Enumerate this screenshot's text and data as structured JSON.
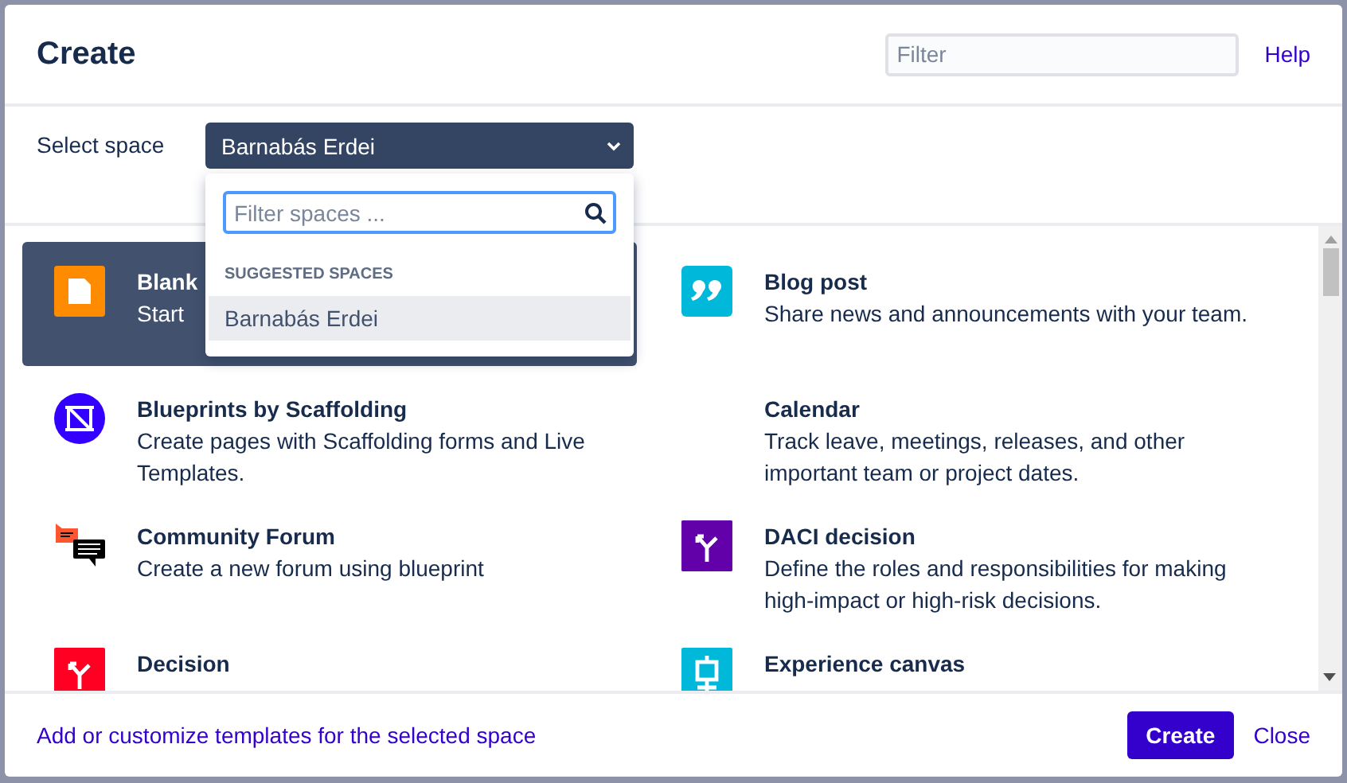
{
  "dialog": {
    "title": "Create",
    "filter": {
      "placeholder": "Filter"
    },
    "help": "Help"
  },
  "space": {
    "label": "Select space",
    "value": "Barnabás Erdei",
    "expanded": true,
    "dropdown": {
      "filter": {
        "placeholder": "Filter spaces ..."
      },
      "section": "SUGGESTED SPACES",
      "options": [
        {
          "label": "Barnabás Erdei",
          "selected": true
        }
      ]
    }
  },
  "templates": [
    {
      "kind": "page",
      "title": "Blank",
      "description": "Start",
      "selected": true
    },
    {
      "kind": "quote",
      "title": "Blog post",
      "description": "Share news and announcements with your team.",
      "selected": false
    },
    {
      "kind": "scaffold",
      "title": "Blueprints by Scaffolding",
      "description": "Create pages with Scaffolding forms and Live Templates.",
      "selected": false
    },
    {
      "kind": "none",
      "title": "Calendar",
      "description": "Track leave, meetings, releases, and other important team or project dates.",
      "selected": false
    },
    {
      "kind": "forum",
      "title": "Community Forum",
      "description": "Create a new forum using blueprint",
      "selected": false
    },
    {
      "kind": "daci",
      "title": "DACI decision",
      "description": "Define the roles and responsibilities for making high-impact or high-risk decisions.",
      "selected": false
    },
    {
      "kind": "decision",
      "title": "Decision",
      "selected": false
    },
    {
      "kind": "canvas",
      "title": "Experience canvas",
      "selected": false
    }
  ],
  "footer": {
    "link": "Add or customize templates for the selected space",
    "create": "Create",
    "close": "Close"
  }
}
